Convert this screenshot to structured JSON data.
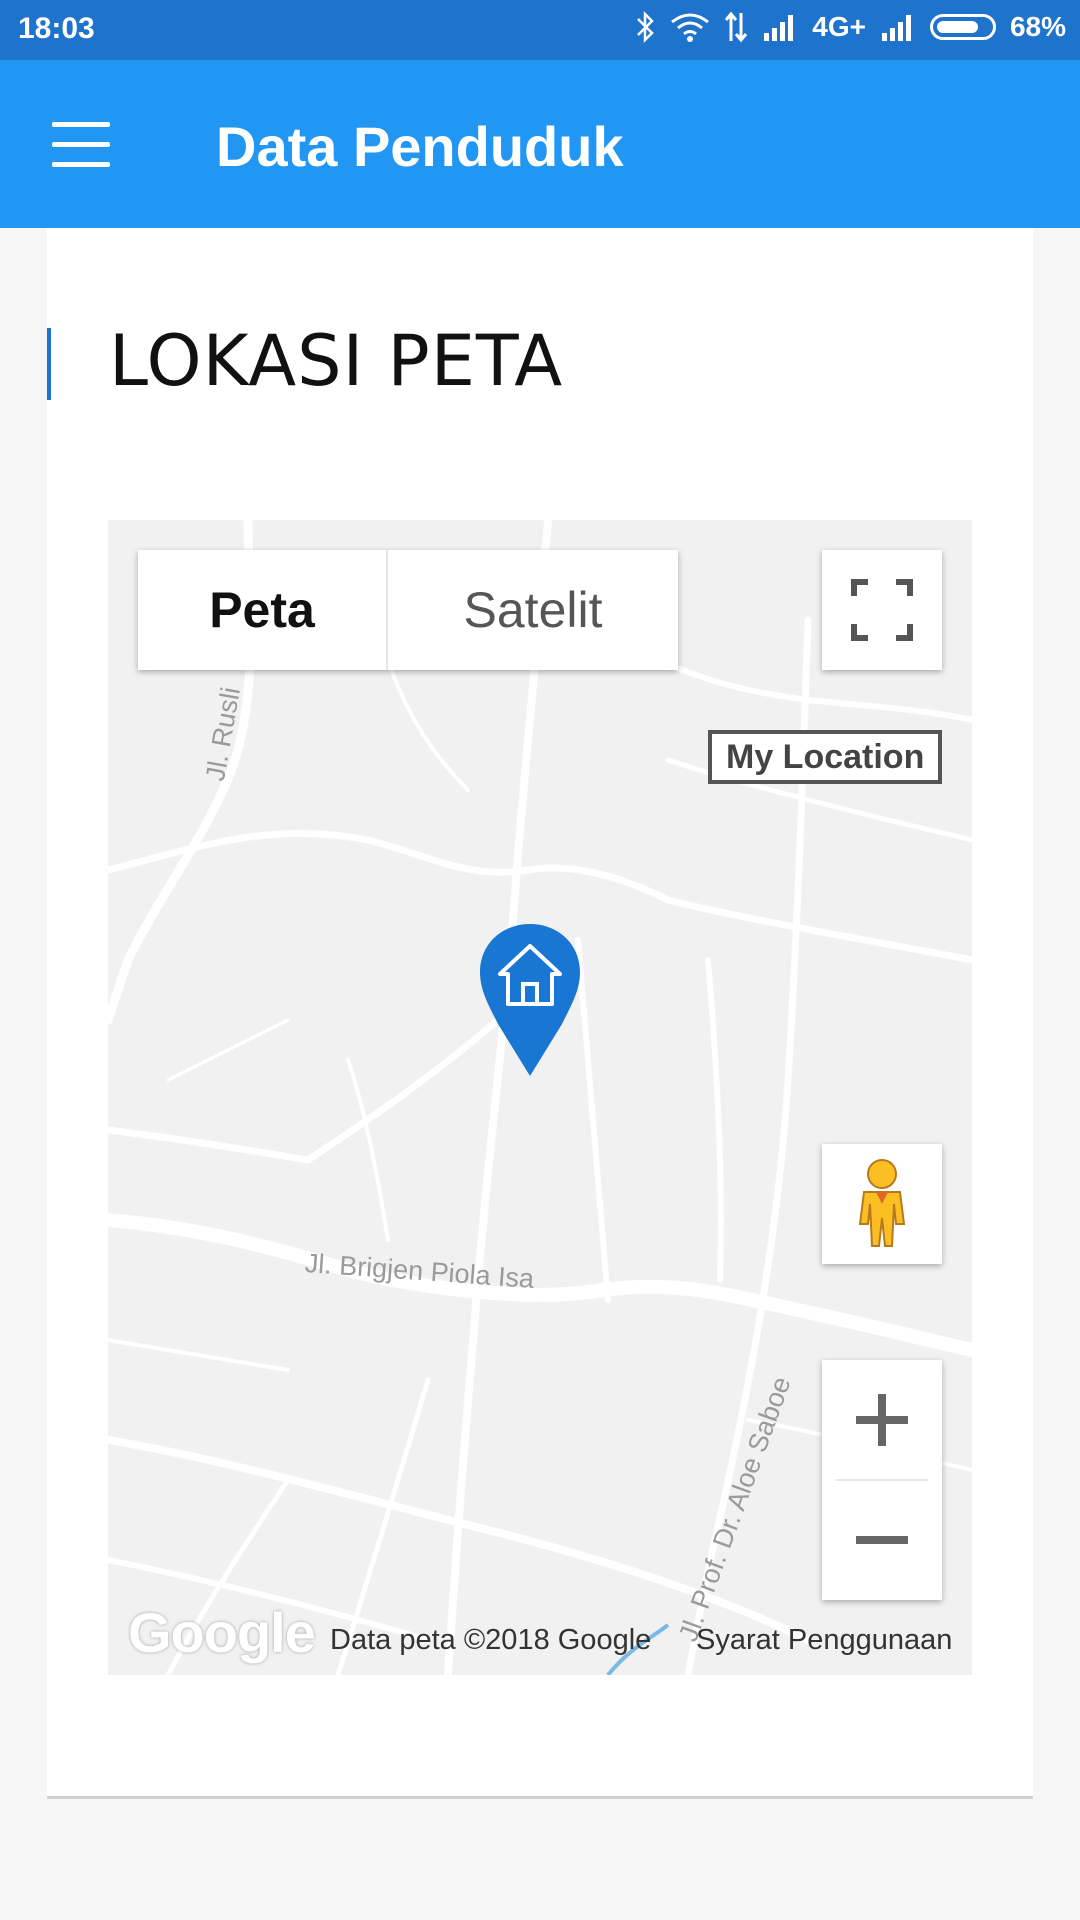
{
  "status_bar": {
    "time": "18:03",
    "network": "4G+",
    "battery": "68%"
  },
  "app_bar": {
    "title": "Data Penduduk",
    "menu_icon": "hamburger-menu-icon"
  },
  "section": {
    "title": "LOKASI PETA"
  },
  "map": {
    "map_types": {
      "active": "Peta",
      "inactive": "Satelit"
    },
    "my_location_label": "My Location",
    "road_labels": [
      "Jl. Rusli",
      "Jl. Brigjen Piola Isa",
      "Jl. Prof. Dr. Aloe Saboe"
    ],
    "logo": "Google",
    "attribution": "Data peta ©2018 Google",
    "terms": "Syarat Penggunaan",
    "marker_icon": "home-marker-icon",
    "colors": {
      "marker": "#1976d2",
      "pegman": "#fbbf24",
      "appbar": "#2196f3",
      "statusbar": "#1e73cd"
    }
  }
}
